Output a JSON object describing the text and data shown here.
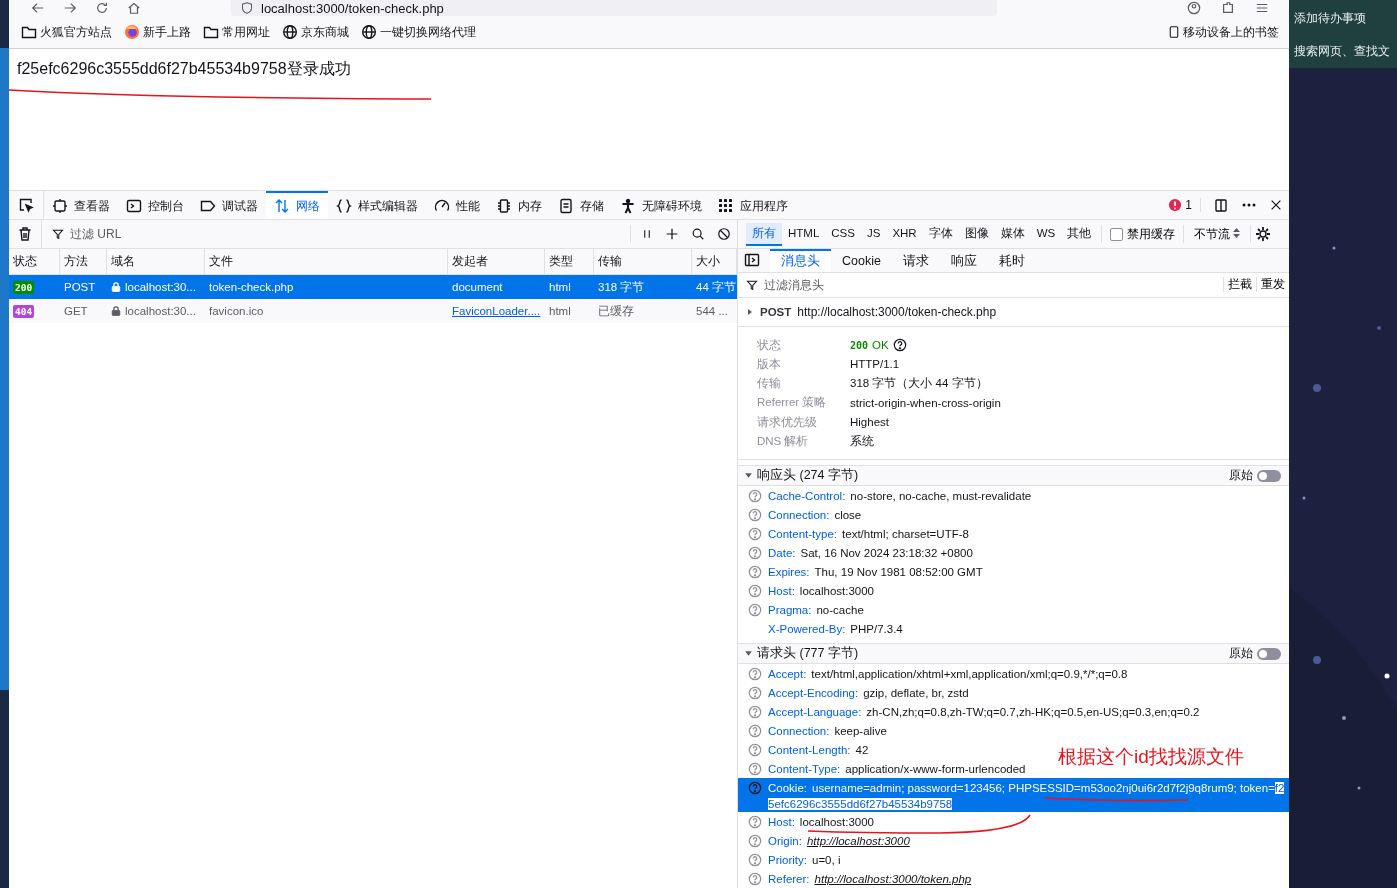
{
  "browser": {
    "url": "localhost:3000/token-check.php"
  },
  "bookmarks": [
    {
      "label": "火狐官方站点"
    },
    {
      "label": "新手上路"
    },
    {
      "label": "常用网址"
    },
    {
      "label": "京东商城"
    },
    {
      "label": "一键切换网络代理"
    }
  ],
  "mobile_bookmarks": "移动设备上的书签",
  "page": {
    "text": "f25efc6296c3555dd6f27b45534b9758登录成功"
  },
  "devtools": {
    "tabs": [
      {
        "label": "查看器",
        "selected": false
      },
      {
        "label": "控制台",
        "selected": false
      },
      {
        "label": "调试器",
        "selected": false
      },
      {
        "label": "网络",
        "selected": true
      },
      {
        "label": "样式编辑器",
        "selected": false
      },
      {
        "label": "性能",
        "selected": false
      },
      {
        "label": "内存",
        "selected": false
      },
      {
        "label": "存储",
        "selected": false
      },
      {
        "label": "无障碍环境",
        "selected": false
      },
      {
        "label": "应用程序",
        "selected": false
      }
    ],
    "error_count": "1",
    "filter_url_placeholder": "过滤 URL",
    "type_filters": [
      {
        "label": "所有",
        "selected": true
      },
      {
        "label": "HTML",
        "selected": false
      },
      {
        "label": "CSS",
        "selected": false
      },
      {
        "label": "JS",
        "selected": false
      },
      {
        "label": "XHR",
        "selected": false
      },
      {
        "label": "字体",
        "selected": false
      },
      {
        "label": "图像",
        "selected": false
      },
      {
        "label": "媒体",
        "selected": false
      },
      {
        "label": "WS",
        "selected": false
      },
      {
        "label": "其他",
        "selected": false
      }
    ],
    "disable_cache": {
      "label": "禁用缓存",
      "checked": false
    },
    "throttle": "不节流",
    "columns": [
      "状态",
      "方法",
      "域名",
      "文件",
      "发起者",
      "类型",
      "传输",
      "大小"
    ],
    "requests": [
      {
        "kind": "ok",
        "status": "200",
        "method": "POST",
        "domain": "localhost:30...",
        "file": "token-check.php",
        "initiator": "document",
        "initiator_link": false,
        "type": "html",
        "transferred": "318 字节",
        "size": "44 字节",
        "selected": true
      },
      {
        "kind": "error",
        "status": "404",
        "method": "GET",
        "domain": "localhost:30...",
        "file": "favicon.ico",
        "initiator": "FaviconLoader....",
        "initiator_link": true,
        "type": "html",
        "transferred": "已缓存",
        "size": "544 ...",
        "selected": false
      }
    ],
    "detail_tabs": [
      {
        "label": "消息头",
        "selected": true
      },
      {
        "label": "Cookie",
        "selected": false
      },
      {
        "label": "请求",
        "selected": false
      },
      {
        "label": "响应",
        "selected": false
      },
      {
        "label": "耗时",
        "selected": false
      }
    ],
    "filter_headers_placeholder": "过滤消息头",
    "actions": [
      "拦截",
      "重发"
    ],
    "request_line": {
      "method": "POST",
      "url": "http://localhost:3000/token-check.php"
    },
    "summary": [
      {
        "label": "状态",
        "code": "200",
        "value": "OK"
      },
      {
        "label": "版本",
        "value": "HTTP/1.1"
      },
      {
        "label": "传输",
        "value": "318 字节（大小 44 字节）"
      },
      {
        "label": "Referrer 策略",
        "value": "strict-origin-when-cross-origin"
      },
      {
        "label": "请求优先级",
        "value": "Highest"
      },
      {
        "label": "DNS 解析",
        "value": "系统"
      }
    ],
    "sections": [
      {
        "title": "响应头 (274 字节)",
        "raw_label": "原始",
        "raw_on": false,
        "expanded": true,
        "headers": [
          {
            "name": "Cache-Control:",
            "value": "no-store, no-cache, must-revalidate",
            "help": true,
            "link": false,
            "selected": false
          },
          {
            "name": "Connection:",
            "value": "close",
            "help": true,
            "link": false,
            "selected": false
          },
          {
            "name": "Content-type:",
            "value": "text/html; charset=UTF-8",
            "help": true,
            "link": false,
            "selected": false
          },
          {
            "name": "Date:",
            "value": "Sat, 16 Nov 2024 23:18:32 +0800",
            "help": true,
            "link": false,
            "selected": false
          },
          {
            "name": "Expires:",
            "value": "Thu, 19 Nov 1981 08:52:00 GMT",
            "help": true,
            "link": false,
            "selected": false
          },
          {
            "name": "Host:",
            "value": "localhost:3000",
            "help": true,
            "link": false,
            "selected": false
          },
          {
            "name": "Pragma:",
            "value": "no-cache",
            "help": true,
            "link": false,
            "selected": false
          },
          {
            "name": "X-Powered-By:",
            "value": "PHP/7.3.4",
            "help": false,
            "link": false,
            "selected": false
          }
        ]
      },
      {
        "title": "请求头 (777 字节)",
        "raw_label": "原始",
        "raw_on": false,
        "expanded": true,
        "headers": [
          {
            "name": "Accept:",
            "value": "text/html,application/xhtml+xml,application/xml;q=0.9,*/*;q=0.8",
            "help": true,
            "link": false,
            "selected": false
          },
          {
            "name": "Accept-Encoding:",
            "value": "gzip, deflate, br, zstd",
            "help": true,
            "link": false,
            "selected": false
          },
          {
            "name": "Accept-Language:",
            "value": "zh-CN,zh;q=0.8,zh-TW;q=0.7,zh-HK;q=0.5,en-US;q=0.3,en;q=0.2",
            "help": true,
            "link": false,
            "selected": false
          },
          {
            "name": "Connection:",
            "value": "keep-alive",
            "help": true,
            "link": false,
            "selected": false
          },
          {
            "name": "Content-Length:",
            "value": "42",
            "help": true,
            "link": false,
            "selected": false
          },
          {
            "name": "Content-Type:",
            "value": "application/x-www-form-urlencoded",
            "help": true,
            "link": false,
            "selected": false
          },
          {
            "name": "Cookie:",
            "value": "username=admin; password=123456; PHPSESSID=m53oo2nj0ui6r2d7f2j9q8rum9; token=",
            "highlight": "f25efc6296c3555dd6f27b45534b9758",
            "help": true,
            "link": false,
            "selected": true
          },
          {
            "name": "Host:",
            "value": "localhost:3000",
            "help": true,
            "link": false,
            "selected": false
          },
          {
            "name": "Origin:",
            "value": "http://localhost:3000",
            "help": true,
            "link": true,
            "selected": false
          },
          {
            "name": "Priority:",
            "value": "u=0, i",
            "help": true,
            "link": false,
            "selected": false
          },
          {
            "name": "Referer:",
            "value": "http://localhost:3000/token.php",
            "help": true,
            "link": true,
            "selected": false
          }
        ]
      }
    ]
  },
  "annotation": {
    "text": "根据这个id找找源文件"
  },
  "desktop": {
    "texts": [
      "添加待办事项",
      "搜索网页、查找文"
    ]
  }
}
